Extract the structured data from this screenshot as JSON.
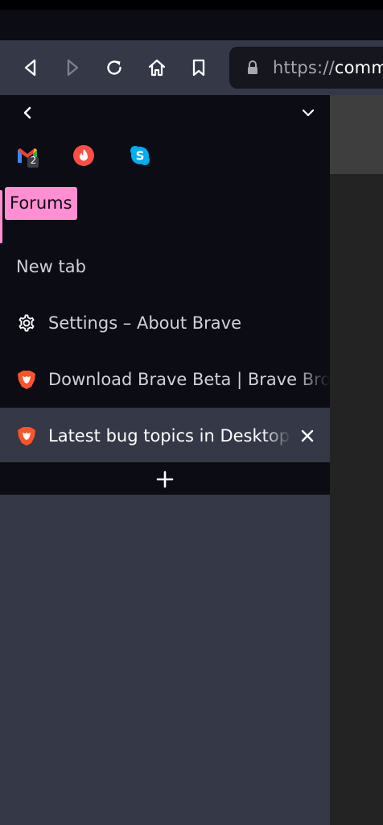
{
  "toolbar": {
    "url_scheme": "https://",
    "url_rest": "comm"
  },
  "sidebar": {
    "pinned_tabs": [
      {
        "name": "Gmail",
        "badge": "2",
        "icon": "gmail-icon"
      },
      {
        "name": "Tinder",
        "icon": "tinder-icon"
      },
      {
        "name": "Skype",
        "icon": "skype-icon"
      }
    ],
    "group": {
      "label": "Forums",
      "color": "#ff8fd2"
    },
    "tabs": [
      {
        "title": "New tab",
        "icon": "none",
        "active": false
      },
      {
        "title": "Settings – About Brave",
        "icon": "gear-icon",
        "active": false
      },
      {
        "title": "Download Brave Beta | Brave Browser",
        "icon": "brave-lion-icon",
        "active": false
      },
      {
        "title": "Latest bug topics in Desktop Support",
        "icon": "brave-lion-icon",
        "active": true
      }
    ]
  },
  "colors": {
    "toolbar_bg": "#343847",
    "sidebar_bg": "#0b0c14",
    "group_accent": "#ff8fd2",
    "brave_orange": "#fb542b"
  }
}
